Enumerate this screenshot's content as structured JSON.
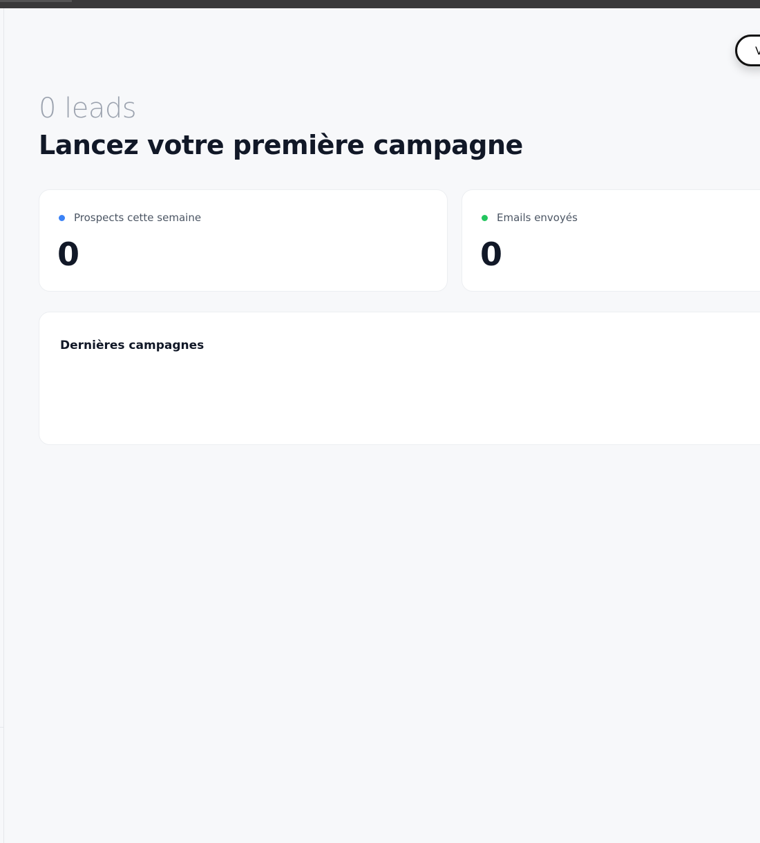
{
  "header": {
    "corner_button_label": "V"
  },
  "hero": {
    "leads_count": "0 leads",
    "headline": "Lancez votre première campagne"
  },
  "stats": [
    {
      "label": "Prospects cette semaine",
      "value": "0",
      "dot_color": "#3b82f6"
    },
    {
      "label": "Emails envoyés",
      "value": "0",
      "dot_color": "#22c55e"
    }
  ],
  "recent": {
    "title": "Dernières campagnes"
  },
  "colors": {
    "background": "#f7f8fa",
    "card": "#ffffff",
    "text_primary": "#111827",
    "text_muted": "#9ca3af",
    "accent_blue": "#3b82f6",
    "accent_green": "#22c55e"
  }
}
